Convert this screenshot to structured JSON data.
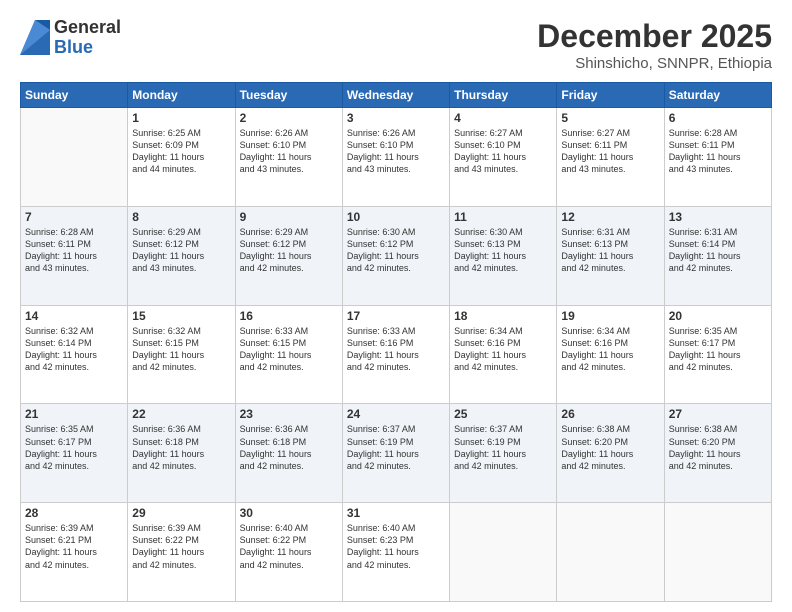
{
  "logo": {
    "general": "General",
    "blue": "Blue"
  },
  "title": "December 2025",
  "location": "Shinshicho, SNNPR, Ethiopia",
  "days": [
    "Sunday",
    "Monday",
    "Tuesday",
    "Wednesday",
    "Thursday",
    "Friday",
    "Saturday"
  ],
  "weeks": [
    [
      {
        "day": "",
        "info": ""
      },
      {
        "day": "1",
        "info": "Sunrise: 6:25 AM\nSunset: 6:09 PM\nDaylight: 11 hours\nand 44 minutes."
      },
      {
        "day": "2",
        "info": "Sunrise: 6:26 AM\nSunset: 6:10 PM\nDaylight: 11 hours\nand 43 minutes."
      },
      {
        "day": "3",
        "info": "Sunrise: 6:26 AM\nSunset: 6:10 PM\nDaylight: 11 hours\nand 43 minutes."
      },
      {
        "day": "4",
        "info": "Sunrise: 6:27 AM\nSunset: 6:10 PM\nDaylight: 11 hours\nand 43 minutes."
      },
      {
        "day": "5",
        "info": "Sunrise: 6:27 AM\nSunset: 6:11 PM\nDaylight: 11 hours\nand 43 minutes."
      },
      {
        "day": "6",
        "info": "Sunrise: 6:28 AM\nSunset: 6:11 PM\nDaylight: 11 hours\nand 43 minutes."
      }
    ],
    [
      {
        "day": "7",
        "info": "Sunrise: 6:28 AM\nSunset: 6:11 PM\nDaylight: 11 hours\nand 43 minutes."
      },
      {
        "day": "8",
        "info": "Sunrise: 6:29 AM\nSunset: 6:12 PM\nDaylight: 11 hours\nand 43 minutes."
      },
      {
        "day": "9",
        "info": "Sunrise: 6:29 AM\nSunset: 6:12 PM\nDaylight: 11 hours\nand 42 minutes."
      },
      {
        "day": "10",
        "info": "Sunrise: 6:30 AM\nSunset: 6:12 PM\nDaylight: 11 hours\nand 42 minutes."
      },
      {
        "day": "11",
        "info": "Sunrise: 6:30 AM\nSunset: 6:13 PM\nDaylight: 11 hours\nand 42 minutes."
      },
      {
        "day": "12",
        "info": "Sunrise: 6:31 AM\nSunset: 6:13 PM\nDaylight: 11 hours\nand 42 minutes."
      },
      {
        "day": "13",
        "info": "Sunrise: 6:31 AM\nSunset: 6:14 PM\nDaylight: 11 hours\nand 42 minutes."
      }
    ],
    [
      {
        "day": "14",
        "info": "Sunrise: 6:32 AM\nSunset: 6:14 PM\nDaylight: 11 hours\nand 42 minutes."
      },
      {
        "day": "15",
        "info": "Sunrise: 6:32 AM\nSunset: 6:15 PM\nDaylight: 11 hours\nand 42 minutes."
      },
      {
        "day": "16",
        "info": "Sunrise: 6:33 AM\nSunset: 6:15 PM\nDaylight: 11 hours\nand 42 minutes."
      },
      {
        "day": "17",
        "info": "Sunrise: 6:33 AM\nSunset: 6:16 PM\nDaylight: 11 hours\nand 42 minutes."
      },
      {
        "day": "18",
        "info": "Sunrise: 6:34 AM\nSunset: 6:16 PM\nDaylight: 11 hours\nand 42 minutes."
      },
      {
        "day": "19",
        "info": "Sunrise: 6:34 AM\nSunset: 6:16 PM\nDaylight: 11 hours\nand 42 minutes."
      },
      {
        "day": "20",
        "info": "Sunrise: 6:35 AM\nSunset: 6:17 PM\nDaylight: 11 hours\nand 42 minutes."
      }
    ],
    [
      {
        "day": "21",
        "info": "Sunrise: 6:35 AM\nSunset: 6:17 PM\nDaylight: 11 hours\nand 42 minutes."
      },
      {
        "day": "22",
        "info": "Sunrise: 6:36 AM\nSunset: 6:18 PM\nDaylight: 11 hours\nand 42 minutes."
      },
      {
        "day": "23",
        "info": "Sunrise: 6:36 AM\nSunset: 6:18 PM\nDaylight: 11 hours\nand 42 minutes."
      },
      {
        "day": "24",
        "info": "Sunrise: 6:37 AM\nSunset: 6:19 PM\nDaylight: 11 hours\nand 42 minutes."
      },
      {
        "day": "25",
        "info": "Sunrise: 6:37 AM\nSunset: 6:19 PM\nDaylight: 11 hours\nand 42 minutes."
      },
      {
        "day": "26",
        "info": "Sunrise: 6:38 AM\nSunset: 6:20 PM\nDaylight: 11 hours\nand 42 minutes."
      },
      {
        "day": "27",
        "info": "Sunrise: 6:38 AM\nSunset: 6:20 PM\nDaylight: 11 hours\nand 42 minutes."
      }
    ],
    [
      {
        "day": "28",
        "info": "Sunrise: 6:39 AM\nSunset: 6:21 PM\nDaylight: 11 hours\nand 42 minutes."
      },
      {
        "day": "29",
        "info": "Sunrise: 6:39 AM\nSunset: 6:22 PM\nDaylight: 11 hours\nand 42 minutes."
      },
      {
        "day": "30",
        "info": "Sunrise: 6:40 AM\nSunset: 6:22 PM\nDaylight: 11 hours\nand 42 minutes."
      },
      {
        "day": "31",
        "info": "Sunrise: 6:40 AM\nSunset: 6:23 PM\nDaylight: 11 hours\nand 42 minutes."
      },
      {
        "day": "",
        "info": ""
      },
      {
        "day": "",
        "info": ""
      },
      {
        "day": "",
        "info": ""
      }
    ]
  ]
}
